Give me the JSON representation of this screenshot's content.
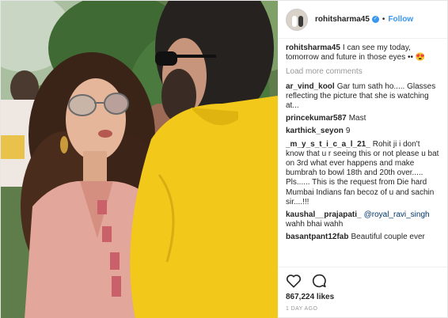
{
  "header": {
    "username": "rohitsharma45",
    "separator": "•",
    "follow_label": "Follow"
  },
  "caption": {
    "username": "rohitsharma45",
    "text": "I can see my today, tomorrow and future in those eyes •• 😍"
  },
  "load_more_label": "Load more comments",
  "comments": [
    {
      "user": "ar_vind_kool",
      "text": "Gar tum sath ho..... Glasses reflecting the picture that she is watching at..."
    },
    {
      "user": "princekumar587",
      "text": "Mast"
    },
    {
      "user": "karthick_seyon",
      "text": "9"
    },
    {
      "user": "_m_y_s_t_i_c_a_l_21_",
      "text": "Rohit ji i don't know that u r seeing this or not please u bat on 3rd what ever happens and make bumbrah to bowl 18th and 20th over..... Pls...... This is the request from Die hard Mumbai Indians fan becoz of u and sachin sir....!!!"
    },
    {
      "user": "kaushal__prajapati_",
      "mention": "@royal_ravi_singh",
      "text": "wahh bhai wahh"
    },
    {
      "user": "basantpant12fab",
      "text": "Beautiful couple ever"
    }
  ],
  "icons": {
    "like": "heart-icon",
    "comment": "comment-bubble-icon"
  },
  "likes": "867,224 likes",
  "posted_ago": "1 DAY AGO",
  "colors": {
    "link": "#3897f0",
    "shirt_yellow": "#f2c81a",
    "kurta_pink": "#e2a79a"
  }
}
